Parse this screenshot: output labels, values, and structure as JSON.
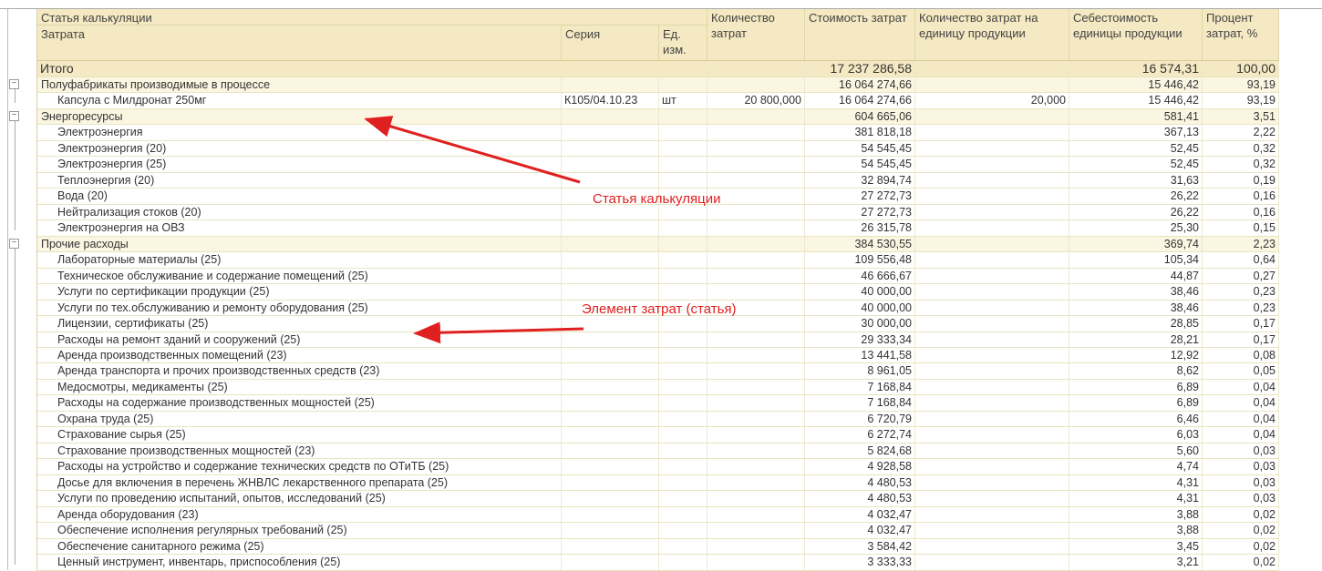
{
  "header": {
    "article": "Статья калькуляции",
    "cost": "Затрата",
    "series": "Серия",
    "unit": "Ед. изм.",
    "qty": "Количество затрат",
    "amount": "Стоимость затрат",
    "qty_per_unit": "Количество затрат на единицу продукции",
    "unit_cost": "Себестоимость единицы продукции",
    "percent": "Процент затрат, %"
  },
  "total": {
    "label": "Итого",
    "amount": "17 237 286,58",
    "unit_cost": "16 574,31",
    "percent": "100,00"
  },
  "rows": [
    {
      "type": "group",
      "name": "Полуфабрикаты производимые в процессе",
      "amount": "16 064 274,66",
      "unit_cost": "15 446,42",
      "percent": "93,19"
    },
    {
      "type": "item",
      "name": "Капсула с Милдронат 250мг",
      "series": "К105/04.10.23",
      "unit": "шт",
      "qty": "20 800,000",
      "amount": "16 064 274,66",
      "qty_per_unit": "20,000",
      "unit_cost": "15 446,42",
      "percent": "93,19"
    },
    {
      "type": "group",
      "name": "Энергоресурсы",
      "amount": "604 665,06",
      "unit_cost": "581,41",
      "percent": "3,51"
    },
    {
      "type": "item",
      "name": "Электроэнергия",
      "amount": "381 818,18",
      "unit_cost": "367,13",
      "percent": "2,22"
    },
    {
      "type": "item",
      "name": "Электроэнергия (20)",
      "amount": "54 545,45",
      "unit_cost": "52,45",
      "percent": "0,32"
    },
    {
      "type": "item",
      "name": "Электроэнергия (25)",
      "amount": "54 545,45",
      "unit_cost": "52,45",
      "percent": "0,32"
    },
    {
      "type": "item",
      "name": "Теплоэнергия (20)",
      "amount": "32 894,74",
      "unit_cost": "31,63",
      "percent": "0,19"
    },
    {
      "type": "item",
      "name": "Вода (20)",
      "amount": "27 272,73",
      "unit_cost": "26,22",
      "percent": "0,16"
    },
    {
      "type": "item",
      "name": "Нейтрализация стоков (20)",
      "amount": "27 272,73",
      "unit_cost": "26,22",
      "percent": "0,16"
    },
    {
      "type": "item",
      "name": "Электроэнергия на ОВЗ",
      "amount": "26 315,78",
      "unit_cost": "25,30",
      "percent": "0,15"
    },
    {
      "type": "group",
      "name": "Прочие расходы",
      "amount": "384 530,55",
      "unit_cost": "369,74",
      "percent": "2,23"
    },
    {
      "type": "item",
      "name": "Лабораторные материалы (25)",
      "amount": "109 556,48",
      "unit_cost": "105,34",
      "percent": "0,64"
    },
    {
      "type": "item",
      "name": "Техническое обслуживание и содержание помещений (25)",
      "amount": "46 666,67",
      "unit_cost": "44,87",
      "percent": "0,27"
    },
    {
      "type": "item",
      "name": "Услуги по сертификации продукции (25)",
      "amount": "40 000,00",
      "unit_cost": "38,46",
      "percent": "0,23"
    },
    {
      "type": "item",
      "name": "Услуги по тех.обслуживанию и ремонту оборудования (25)",
      "amount": "40 000,00",
      "unit_cost": "38,46",
      "percent": "0,23"
    },
    {
      "type": "item",
      "name": "Лицензии, сертификаты (25)",
      "amount": "30 000,00",
      "unit_cost": "28,85",
      "percent": "0,17"
    },
    {
      "type": "item",
      "name": "Расходы на ремонт зданий и сооружений (25)",
      "amount": "29 333,34",
      "unit_cost": "28,21",
      "percent": "0,17"
    },
    {
      "type": "item",
      "name": "Аренда производственных помещений (23)",
      "amount": "13 441,58",
      "unit_cost": "12,92",
      "percent": "0,08"
    },
    {
      "type": "item",
      "name": "Аренда транспорта и прочих производственных средств (23)",
      "amount": "8 961,05",
      "unit_cost": "8,62",
      "percent": "0,05"
    },
    {
      "type": "item",
      "name": "Медосмотры, медикаменты (25)",
      "amount": "7 168,84",
      "unit_cost": "6,89",
      "percent": "0,04"
    },
    {
      "type": "item",
      "name": "Расходы на содержание производственных мощностей (25)",
      "amount": "7 168,84",
      "unit_cost": "6,89",
      "percent": "0,04"
    },
    {
      "type": "item",
      "name": "Охрана труда (25)",
      "amount": "6 720,79",
      "unit_cost": "6,46",
      "percent": "0,04"
    },
    {
      "type": "item",
      "name": "Страхование сырья (25)",
      "amount": "6 272,74",
      "unit_cost": "6,03",
      "percent": "0,04"
    },
    {
      "type": "item",
      "name": "Страхование производственных мощностей (23)",
      "amount": "5 824,68",
      "unit_cost": "5,60",
      "percent": "0,03"
    },
    {
      "type": "item",
      "name": "Расходы на устройство и содержание технических средств по ОТиТБ (25)",
      "amount": "4 928,58",
      "unit_cost": "4,74",
      "percent": "0,03"
    },
    {
      "type": "item",
      "name": "Досье для включения в перечень ЖНВЛС лекарственного препарата (25)",
      "amount": "4 480,53",
      "unit_cost": "4,31",
      "percent": "0,03"
    },
    {
      "type": "item",
      "name": "Услуги по проведению испытаний, опытов, исследований (25)",
      "amount": "4 480,53",
      "unit_cost": "4,31",
      "percent": "0,03"
    },
    {
      "type": "item",
      "name": "Аренда оборудования (23)",
      "amount": "4 032,47",
      "unit_cost": "3,88",
      "percent": "0,02"
    },
    {
      "type": "item",
      "name": "Обеспечение исполнения регулярных требований (25)",
      "amount": "4 032,47",
      "unit_cost": "3,88",
      "percent": "0,02"
    },
    {
      "type": "item",
      "name": "Обеспечение санитарного режима (25)",
      "amount": "3 584,42",
      "unit_cost": "3,45",
      "percent": "0,02"
    },
    {
      "type": "item",
      "name": "Ценный инструмент, инвентарь, приспособления (25)",
      "amount": "3 333,33",
      "unit_cost": "3,21",
      "percent": "0,02"
    }
  ],
  "annotations": {
    "article": "Статья калькуляции",
    "element": "Элемент затрат (статья)"
  },
  "colors": {
    "header_bg": "#f4e9c2",
    "group_bg": "#fbf6e2",
    "arrow": "#e02020"
  }
}
